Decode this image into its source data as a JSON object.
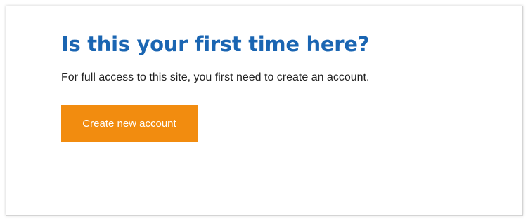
{
  "signup": {
    "heading": "Is this your first time here?",
    "description": "For full access to this site, you first need to create an account.",
    "button_label": "Create new account"
  },
  "colors": {
    "heading": "#1a65b2",
    "button_background": "#f28c0f",
    "button_text": "#ffffff",
    "text": "#222222"
  }
}
